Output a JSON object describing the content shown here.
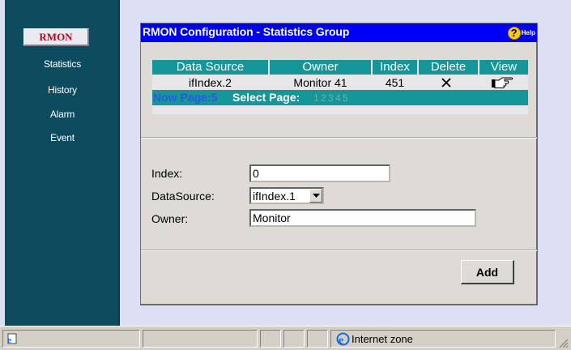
{
  "sidebar": {
    "title": "RMON",
    "items": [
      {
        "label": "Statistics"
      },
      {
        "label": "History"
      },
      {
        "label": "Alarm"
      },
      {
        "label": "Event"
      }
    ]
  },
  "panel": {
    "title": "RMON Configuration - Statistics Group",
    "help_label": "Help",
    "help_icon": "?"
  },
  "table": {
    "columns": [
      "Data Source",
      "Owner",
      "Index",
      "Delete",
      "View"
    ],
    "rows": [
      {
        "data_source": "ifIndex.2",
        "owner": "Monitor 41",
        "index": "451",
        "delete_icon": "x-icon",
        "view_icon": "pointing-hand-icon"
      }
    ],
    "now_page": "Now Page:5",
    "select_page_label": "Select Page:",
    "pages": [
      "1",
      "2",
      "3",
      "4",
      "5"
    ]
  },
  "form": {
    "index_label": "Index:",
    "index_value": "0",
    "datasource_label": "DataSource:",
    "datasource_value": "ifIndex.1",
    "owner_label": "Owner:",
    "owner_value": "Monitor",
    "add_label": "Add"
  },
  "statusbar": {
    "zone": "Internet zone"
  },
  "colors": {
    "sidebar_bg": "#0d4b5e",
    "title_bar": "#0000f5",
    "table_header": "#159698",
    "accent_red": "#c6001a"
  }
}
